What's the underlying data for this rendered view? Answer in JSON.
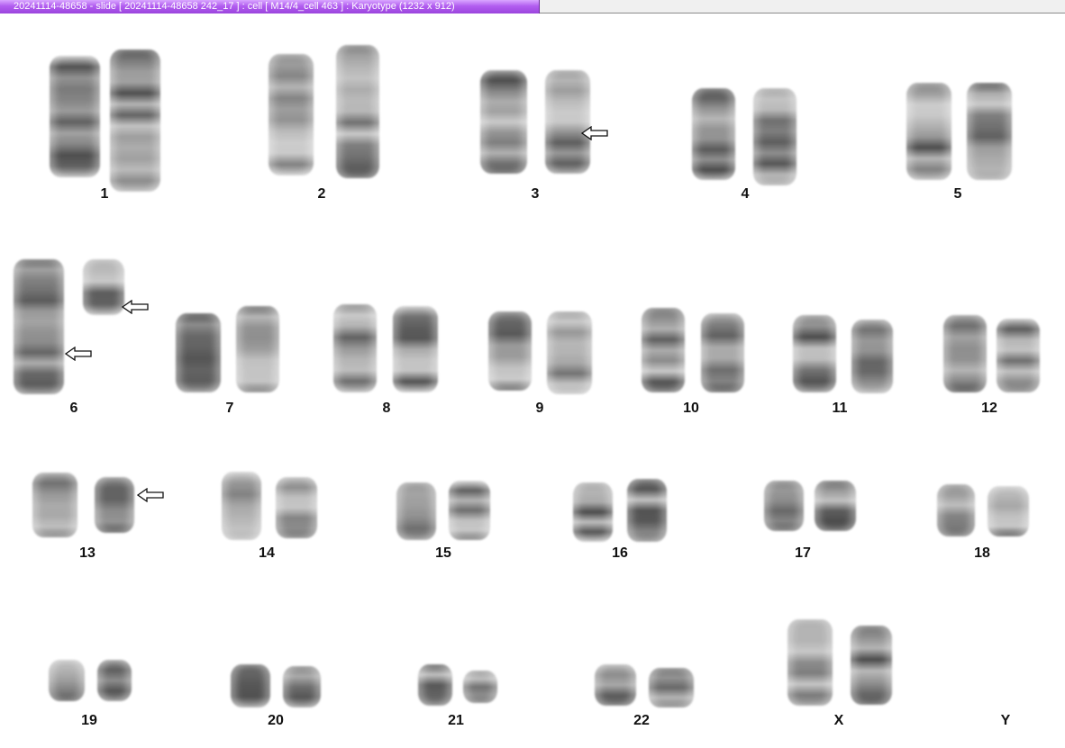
{
  "window": {
    "title": "20241114-48658 - slide [ 20241114-48658 242_17 ] : cell [ M14/4_cell 463 ] : Karyotype  (1232 x 912)"
  },
  "karyotype": {
    "labels": [
      "1",
      "2",
      "3",
      "4",
      "5",
      "6",
      "7",
      "8",
      "9",
      "10",
      "11",
      "12",
      "13",
      "14",
      "15",
      "16",
      "17",
      "18",
      "19",
      "20",
      "21",
      "22",
      "X",
      "Y"
    ],
    "marker_icon": "hollow-left-arrow-icon",
    "marked_chromosomes": [
      "3",
      "6",
      "6",
      "13"
    ]
  },
  "colors": {
    "title_tab": "#a64fe6",
    "background": "#ffffff"
  }
}
